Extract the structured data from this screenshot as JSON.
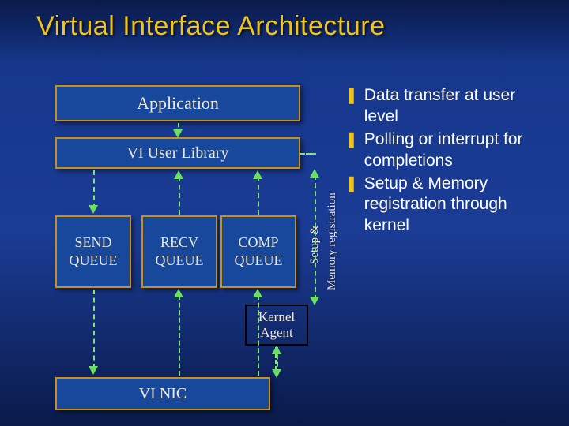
{
  "title": "Virtual Interface Architecture",
  "boxes": {
    "application": "Application",
    "library": "VI User Library",
    "send_queue": "SEND\nQUEUE",
    "recv_queue": "RECV\nQUEUE",
    "comp_queue": "COMP\nQUEUE",
    "kernel_agent": "Kernel\nAgent",
    "nic": "VI NIC"
  },
  "side_label": {
    "line1": "Setup &",
    "line2": "Memory registration"
  },
  "bullets": [
    "Data transfer at user level",
    "Polling or interrupt for completions",
    "Setup & Memory registration through kernel"
  ],
  "bullet_glyph": "❚"
}
